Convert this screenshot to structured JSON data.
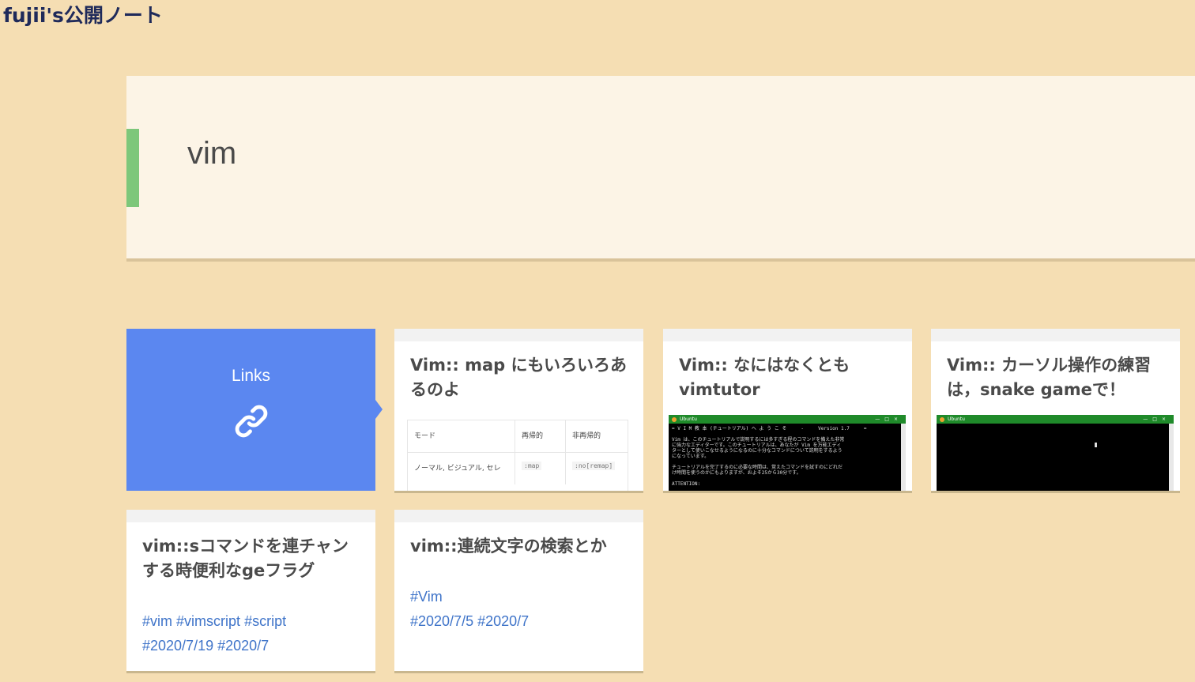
{
  "header": {
    "project_name": "fujii's公開ノート"
  },
  "page": {
    "title": "vim"
  },
  "links_card": {
    "label": "Links",
    "icon": "link-icon"
  },
  "cards": [
    {
      "title": "Vim:: map にもいろいろあるのよ",
      "thumbnail": {
        "type": "table",
        "headers": [
          "モード",
          "再帰的",
          "非再帰的"
        ],
        "rows": [
          [
            "ノーマル, ビジュアル, セレ",
            ":map",
            ":no[remap]"
          ]
        ]
      }
    },
    {
      "title": "Vim:: なにはなくともvimtutor",
      "thumbnail": {
        "type": "terminal",
        "window_title": "Ubuntu",
        "lines": [
          "= V I M 教 本 (チュートリアル) へ よ う こ そ     -     Version 1.7     =",
          "",
          "Vim は、このチュートリアルで説明するには多すぎる程のコマンドを備えた非常",
          "に強力なエディターです。このチュートリアルは、あなたが Vim を万能エディ",
          "ターとして使いこなせるようになるのに十分なコマンドについて説明をするよう",
          "になっています。",
          "",
          "チュートリアルを完了するのに必要な時間は、覚えたコマンドを試すのにどれだ",
          "け時間を使うのかにもよりますが、およそ25から30分です。",
          "",
          "ATTENTION:"
        ]
      }
    },
    {
      "title": "Vim:: カーソル操作の練習は，snake gameで！",
      "thumbnail": {
        "type": "terminal",
        "window_title": "Ubuntu",
        "lines": []
      }
    },
    {
      "title": "vim::sコマンドを連チャンする時便利なgeフラグ",
      "tags": [
        "#vim",
        "#vimscript",
        "#script"
      ],
      "dates": [
        "#2020/7/19",
        "#2020/7"
      ]
    },
    {
      "title": "vim::連続文字の検索とか",
      "tags": [
        "#Vim"
      ],
      "dates": [
        "#2020/7/5",
        "#2020/7"
      ]
    }
  ],
  "colors": {
    "background": "#f5deb3",
    "title_card": "#fcf4e6",
    "title_accent": "#7dc77a",
    "links_card": "#5b87f0",
    "tag_link": "#3f74c9",
    "project_name": "#1f2a5a"
  }
}
